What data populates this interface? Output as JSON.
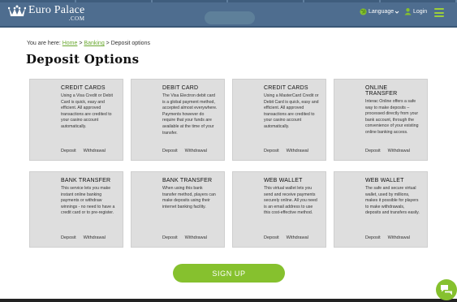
{
  "header": {
    "logo_main": "Euro Palace",
    "logo_sub": ".COM",
    "language_label": "Language",
    "login_label": "Login"
  },
  "breadcrumb": {
    "prefix": "You are here:",
    "items": [
      "Home",
      "Banking",
      "Deposit options"
    ],
    "separator": ">"
  },
  "page_title": "Deposit Options",
  "cards": [
    {
      "title": "CREDIT CARDS",
      "desc": "Using a Visa Credit or Debit Card is quick, easy and efficient. All approved transactions are credited to your casino account automatically.",
      "deposit": "Deposit",
      "withdrawal": "Withdrawal"
    },
    {
      "title": "DEBIT CARD",
      "desc": "The Visa Electron debit card is a global payment method, accepted almost everywhere. Payments however do require that your funds are available at the time of your transfer.",
      "deposit": "Deposit",
      "withdrawal": "Withdrawal"
    },
    {
      "title": "CREDIT CARDS",
      "desc": "Using a MasterCard Credit or Debit Card is quick, easy and efficient. All approved transactions are credited to your casino account automatically.",
      "deposit": "Deposit",
      "withdrawal": "Withdrawal"
    },
    {
      "title": "ONLINE TRANSFER",
      "desc": "Interac Online offers a safe way to make deposits – processed directly from your bank account, through the convenience of your existing online banking access.",
      "deposit": "Deposit",
      "withdrawal": "Withdrawal"
    },
    {
      "title": "BANK TRANSFER",
      "desc": "This service lets you make instant online banking payments or withdraw winnings - no need to have a credit card or to pre-register.",
      "deposit": "Deposit",
      "withdrawal": "Withdrawal"
    },
    {
      "title": "BANK TRANSFER",
      "desc": "When using this bank transfer method, players can make deposits using their internet banking facility.",
      "deposit": "Deposit",
      "withdrawal": "Withdrawal"
    },
    {
      "title": "WEB WALLET",
      "desc": "This virtual wallet lets you send and receive payments securely online. All you need is an email address to use this cost-effective method.",
      "deposit": "Deposit",
      "withdrawal": "Withdrawal"
    },
    {
      "title": "WEB WALLET",
      "desc": "The safe and secure virtual wallet, used by millions, makes it possible for players to make withdrawals, deposits and transfers easily.",
      "deposit": "Deposit",
      "withdrawal": "Withdrawal"
    }
  ],
  "signup_label": "SIGN UP",
  "icons": {
    "crown": "crown-icon",
    "globe": "globe-icon",
    "user": "user-icon",
    "menu": "hamburger-menu-icon",
    "chat": "chat-icon"
  },
  "colors": {
    "header_bg": "#4e6d8f",
    "accent_green": "#86c12e",
    "link_green": "#6aa830",
    "card_bg": "#dedede"
  }
}
